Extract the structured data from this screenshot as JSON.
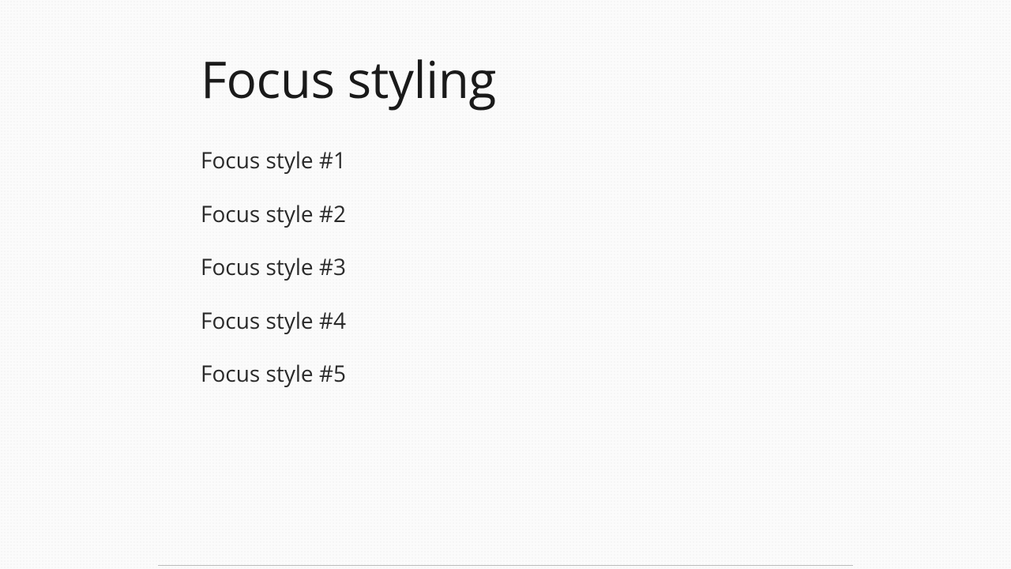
{
  "heading": "Focus styling",
  "links": [
    {
      "label": "Focus style #1"
    },
    {
      "label": "Focus style #2"
    },
    {
      "label": "Focus style #3"
    },
    {
      "label": "Focus style #4"
    },
    {
      "label": "Focus style #5"
    }
  ]
}
